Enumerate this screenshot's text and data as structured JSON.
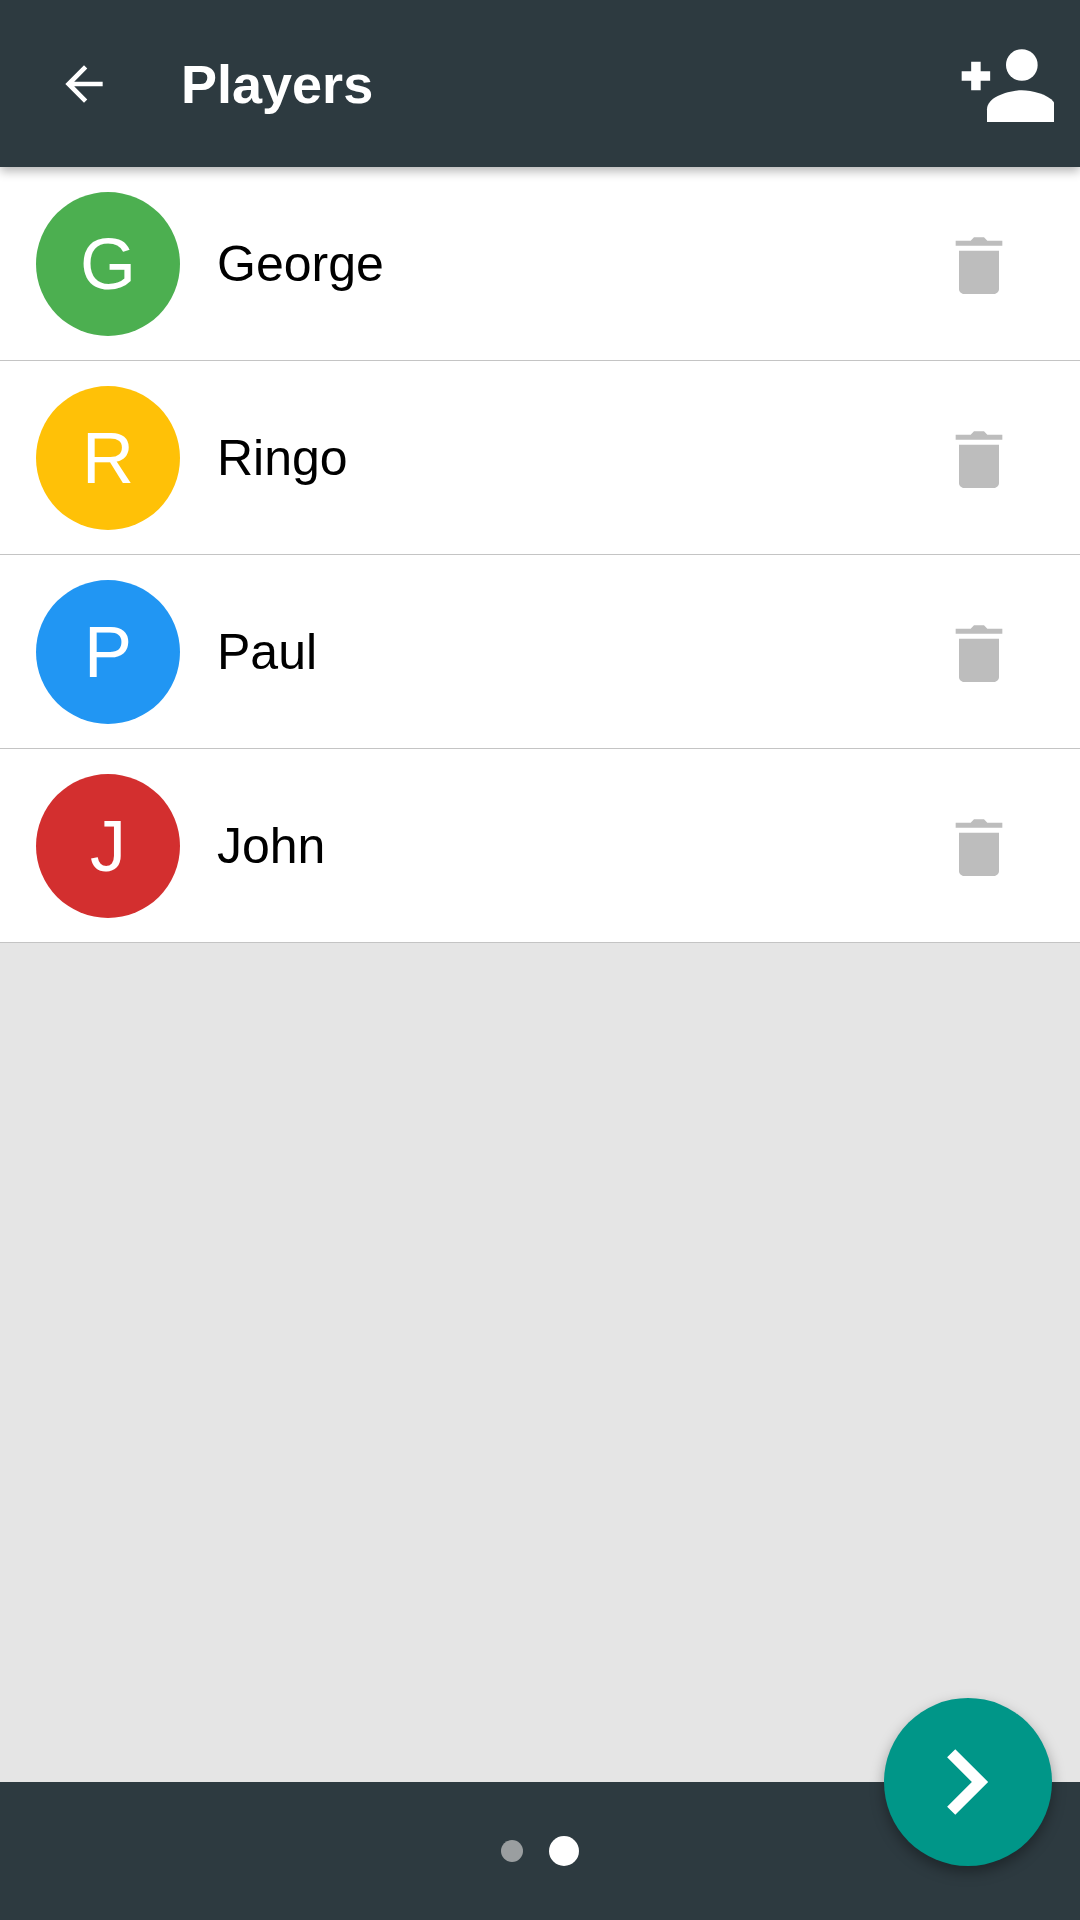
{
  "app_bar": {
    "title": "Players"
  },
  "players": [
    {
      "initial": "G",
      "name": "George",
      "color": "#4caf50"
    },
    {
      "initial": "R",
      "name": "Ringo",
      "color": "#ffc107"
    },
    {
      "initial": "P",
      "name": "Paul",
      "color": "#2196f3"
    },
    {
      "initial": "J",
      "name": "John",
      "color": "#d32f2f"
    }
  ],
  "page_indicator": [
    {
      "selected": false
    },
    {
      "selected": true
    }
  ]
}
